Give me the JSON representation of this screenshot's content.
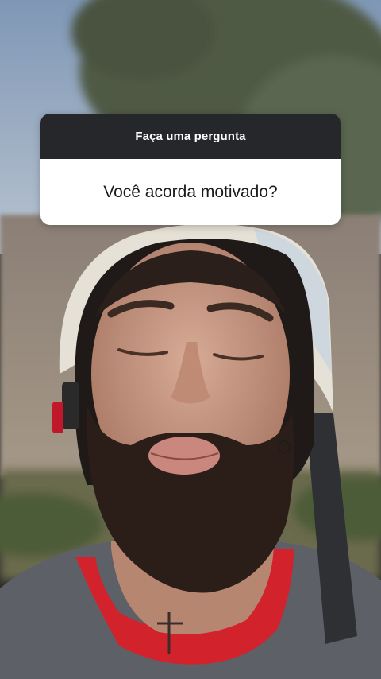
{
  "question_sticker": {
    "header": "Faça uma pergunta",
    "question": "Você acorda motivado?"
  },
  "background": {
    "description_icon": "person-photo",
    "colors": {
      "sky": "#8fa3bc",
      "tree": "#556049",
      "wall": "#9c8f83",
      "skin": "#c79a86",
      "beard": "#2b1e18",
      "helmet": "#e4e0d8",
      "shirt_red": "#d3202b",
      "shirt_gray": "#5c5e66"
    }
  }
}
